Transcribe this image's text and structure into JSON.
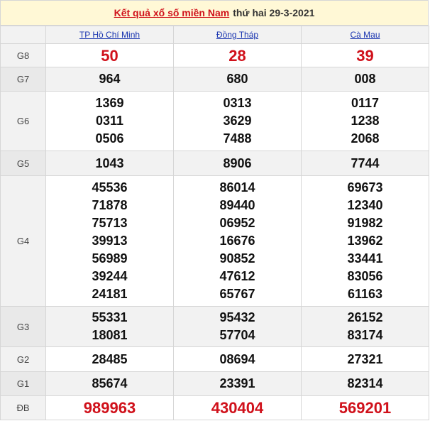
{
  "header": {
    "link_text": "Kết quả xổ số miền Nam",
    "date_text": "thứ hai 29-3-2021"
  },
  "provinces": [
    "TP Hồ Chí Minh",
    "Đồng Tháp",
    "Cà Mau"
  ],
  "prizes": [
    {
      "label": "G8",
      "values": [
        [
          "50"
        ],
        [
          "28"
        ],
        [
          "39"
        ]
      ]
    },
    {
      "label": "G7",
      "values": [
        [
          "964"
        ],
        [
          "680"
        ],
        [
          "008"
        ]
      ]
    },
    {
      "label": "G6",
      "values": [
        [
          "1369",
          "0311",
          "0506"
        ],
        [
          "0313",
          "3629",
          "7488"
        ],
        [
          "0117",
          "1238",
          "2068"
        ]
      ]
    },
    {
      "label": "G5",
      "values": [
        [
          "1043"
        ],
        [
          "8906"
        ],
        [
          "7744"
        ]
      ]
    },
    {
      "label": "G4",
      "values": [
        [
          "45536",
          "71878",
          "75713",
          "39913",
          "56989",
          "39244",
          "24181"
        ],
        [
          "86014",
          "89440",
          "06952",
          "16676",
          "90852",
          "47612",
          "65767"
        ],
        [
          "69673",
          "12340",
          "91982",
          "13962",
          "33441",
          "83056",
          "61163"
        ]
      ]
    },
    {
      "label": "G3",
      "values": [
        [
          "55331",
          "18081"
        ],
        [
          "95432",
          "57704"
        ],
        [
          "26152",
          "83174"
        ]
      ]
    },
    {
      "label": "G2",
      "values": [
        [
          "28485"
        ],
        [
          "08694"
        ],
        [
          "27321"
        ]
      ]
    },
    {
      "label": "G1",
      "values": [
        [
          "85674"
        ],
        [
          "23391"
        ],
        [
          "82314"
        ]
      ]
    },
    {
      "label": "ĐB",
      "values": [
        [
          "989963"
        ],
        [
          "430404"
        ],
        [
          "569201"
        ]
      ]
    }
  ],
  "colors": {
    "accent_red": "#d0111b",
    "link_blue": "#1a35b0",
    "header_bg": "#fff8d6",
    "row_alt": "#f2f2f2"
  }
}
